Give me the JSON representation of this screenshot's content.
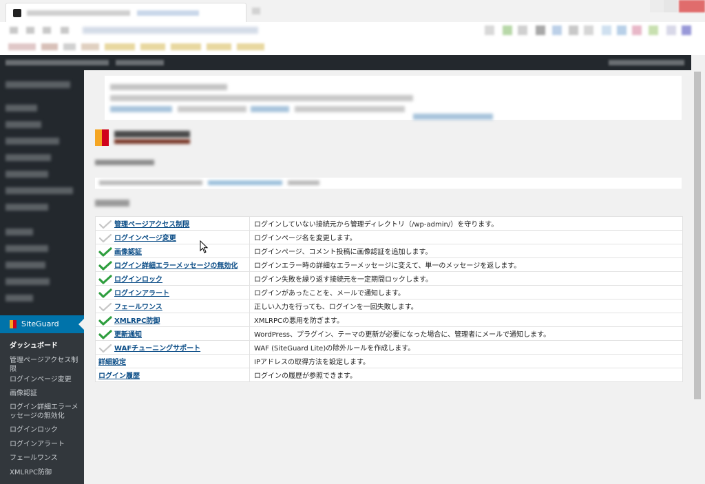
{
  "sidebar": {
    "plugin_label": "SiteGuard",
    "submenu": [
      "ダッシュボード",
      "管理ページアクセス制限",
      "ログインページ変更",
      "画像認証",
      "ログイン詳細エラーメッセージの無効化",
      "ログインロック",
      "ログインアラート",
      "フェールワンス",
      "XMLRPC防御"
    ]
  },
  "features": [
    {
      "name": "管理ページアクセス制限",
      "desc": "ログインしていない接続元から管理ディレクトリ（/wp-admin/）を守ります。",
      "status": "off"
    },
    {
      "name": "ログインページ変更",
      "desc": "ログインページ名を変更します。",
      "status": "off"
    },
    {
      "name": "画像認証",
      "desc": "ログインページ、コメント投稿に画像認証を追加します。",
      "status": "on"
    },
    {
      "name": "ログイン詳細エラーメッセージの無効化",
      "desc": "ログインエラー時の詳細なエラーメッセージに変えて、単一のメッセージを返します。",
      "status": "on"
    },
    {
      "name": "ログインロック",
      "desc": "ログイン失敗を繰り返す接続元を一定期間ロックします。",
      "status": "on"
    },
    {
      "name": "ログインアラート",
      "desc": "ログインがあったことを、メールで通知します。",
      "status": "on"
    },
    {
      "name": "フェールワンス",
      "desc": "正しい入力を行っても、ログインを一回失敗します。",
      "status": "off"
    },
    {
      "name": "XMLRPC防御",
      "desc": "XMLRPCの悪用を防ぎます。",
      "status": "on"
    },
    {
      "name": "更新通知",
      "desc": "WordPress、プラグイン、テーマの更新が必要になった場合に、管理者にメールで通知します。",
      "status": "on"
    },
    {
      "name": "WAFチューニングサポート",
      "desc": "WAF (SiteGuard Lite)の除外ルールを作成します。",
      "status": "off"
    },
    {
      "name": "詳細設定",
      "desc": "IPアドレスの取得方法を設定します。",
      "status": "none"
    },
    {
      "name": "ログイン履歴",
      "desc": "ログインの履歴が参照できます。",
      "status": "none"
    }
  ],
  "colors": {
    "check_on": "#2e9e3e",
    "check_off": "#c7c7c7",
    "link": "#0a4c86",
    "accent": "#0073aa",
    "sidebar_bg": "#23282d"
  },
  "icons": {
    "enabled": "green-check-icon",
    "disabled": "gray-check-icon",
    "plugin": "siteguard-logo-icon",
    "pointer": "mouse-cursor-icon"
  }
}
